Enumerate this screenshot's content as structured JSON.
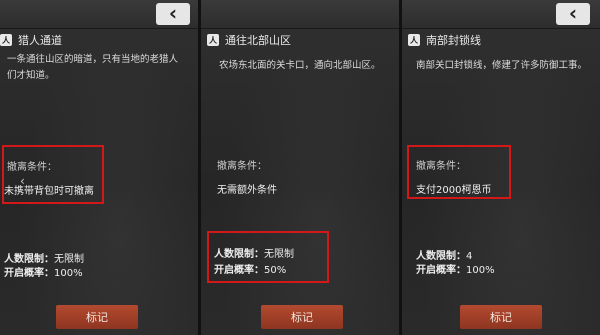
{
  "panels": [
    {
      "title": "猎人通道",
      "title_icon": "人",
      "description": "一条通往山区的暗道，只有当地的老猎人们才知道。",
      "condition_label": "撤离条件：",
      "condition_value": "未携带背包时可撤离",
      "limit_label": "人数限制：",
      "limit_value": "无限制",
      "rate_label": "开启概率：",
      "rate_value": "100%",
      "button": "标记"
    },
    {
      "title": "通往北部山区",
      "title_icon": "人",
      "description": "农场东北面的关卡口，通向北部山区。",
      "condition_label": "撤离条件：",
      "condition_value": "无需额外条件",
      "limit_label": "人数限制：",
      "limit_value": "无限制",
      "rate_label": "开启概率：",
      "rate_value": "50%",
      "button": "标记"
    },
    {
      "title": "南部封锁线",
      "title_icon": "人",
      "description": "南部关口封锁线，修建了许多防御工事。",
      "condition_label": "撤离条件：",
      "condition_value": "支付2000柯恩币",
      "limit_label": "人数限制：",
      "limit_value": "4",
      "rate_label": "开启概率：",
      "rate_value": "100%",
      "button": "标记"
    }
  ],
  "back_glyph": "‹",
  "icons": {
    "back": "chevron-left-icon",
    "title": "exit-person-icon",
    "first_panel_cursor": "chevron-left-icon"
  },
  "colors": {
    "highlight_box": "#d21818",
    "mark_button": "#a0402a"
  }
}
